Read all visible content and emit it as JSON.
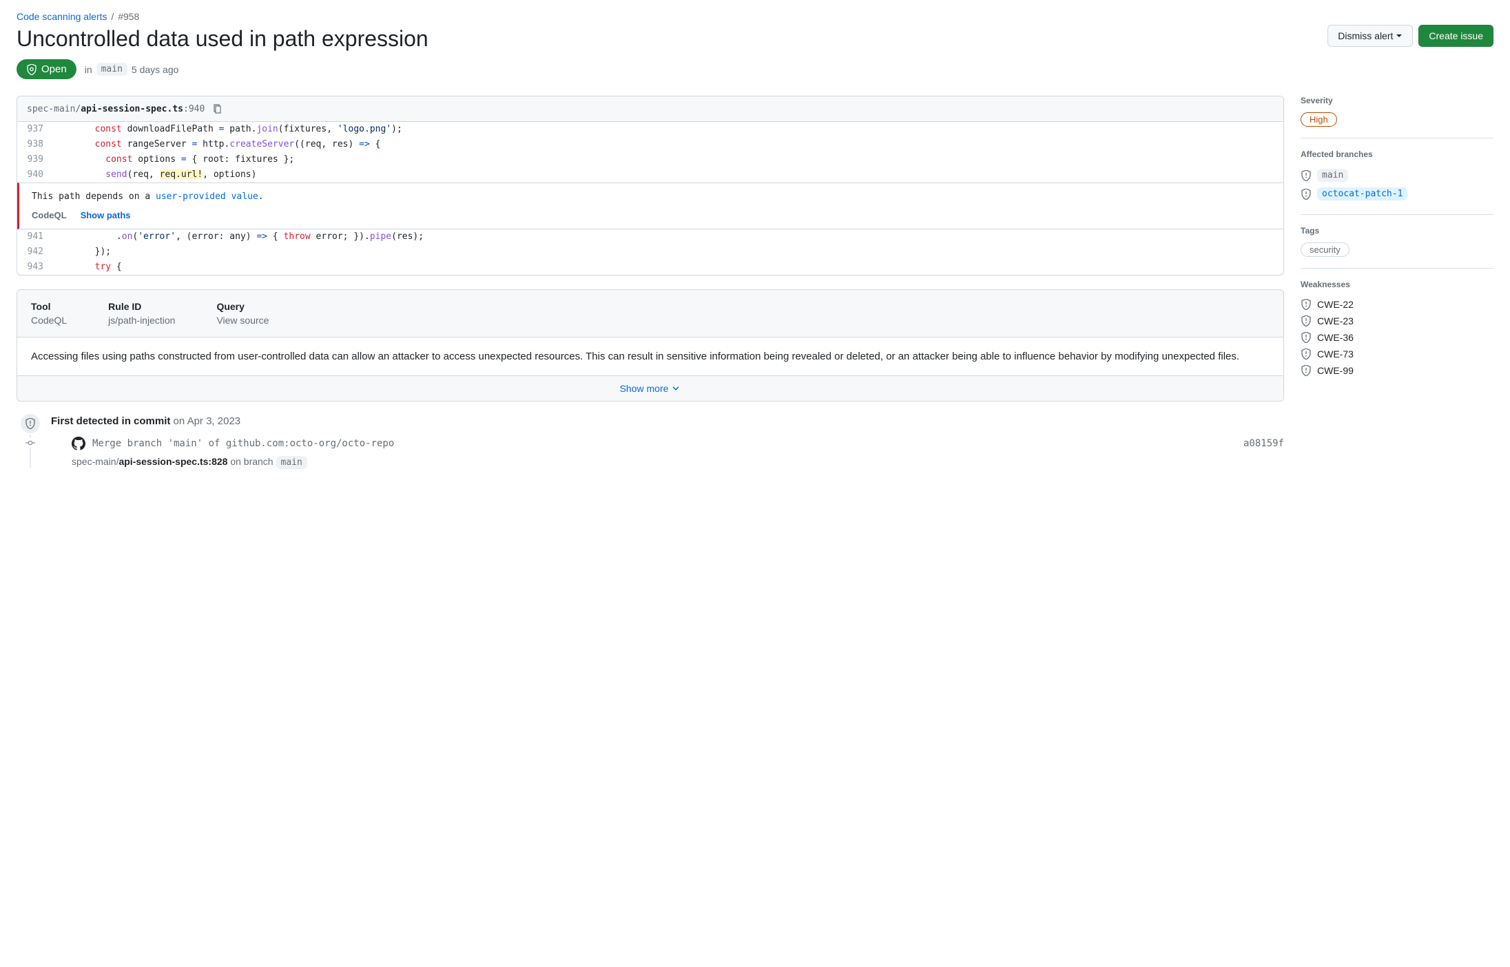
{
  "breadcrumb": {
    "parent": "Code scanning alerts",
    "id": "#958"
  },
  "title": "Uncontrolled data used in path expression",
  "actions": {
    "dismiss": "Dismiss alert",
    "create_issue": "Create issue"
  },
  "status": {
    "label": "Open",
    "in": "in",
    "branch": "main",
    "age": "5 days ago"
  },
  "code_header": {
    "path_prefix": "spec-main/",
    "path_bold": "api-session-spec.ts",
    "line": ":940"
  },
  "code_lines": {
    "937": {
      "ln": "937"
    },
    "938": {
      "ln": "938"
    },
    "939": {
      "ln": "939"
    },
    "940": {
      "ln": "940"
    },
    "941": {
      "ln": "941"
    },
    "942": {
      "ln": "942"
    },
    "943": {
      "ln": "943"
    }
  },
  "code_tokens": {
    "l937_const": "const",
    "l937_var": " downloadFilePath ",
    "l937_eq": "=",
    "l937_sp": " path.",
    "l937_join": "join",
    "l937_p1": "(fixtures, ",
    "l937_str": "'logo.png'",
    "l937_p2": ");",
    "l938_const": "const",
    "l938_var": " rangeServer ",
    "l938_eq": "=",
    "l938_sp": " http.",
    "l938_create": "createServer",
    "l938_p1": "((req, res) ",
    "l938_arrow": "=>",
    "l938_p2": " {",
    "l939_const": "const",
    "l939_var": " options ",
    "l939_eq": "=",
    "l939_rest": " { root: fixtures };",
    "l940_send": "send",
    "l940_p1": "(req, ",
    "l940_hl": "req.url!",
    "l940_p2": ", options)",
    "l941_on": "on",
    "l941_p0": ".",
    "l941_p1": "(",
    "l941_str": "'error'",
    "l941_p2": ", (error: any) ",
    "l941_arrow": "=>",
    "l941_p3": " { ",
    "l941_throw": "throw",
    "l941_p4": " error; }).",
    "l941_pipe": "pipe",
    "l941_p5": "(res);",
    "l942": "});",
    "l943_try": "try",
    "l943_rest": " {"
  },
  "inline_msg": {
    "prefix": "This path depends on a ",
    "link": "user-provided value",
    "suffix": ".",
    "tool": "CodeQL",
    "show_paths": "Show paths"
  },
  "details": {
    "tool_h": "Tool",
    "tool_v": "CodeQL",
    "rule_h": "Rule ID",
    "rule_v": "js/path-injection",
    "query_h": "Query",
    "query_v": "View source",
    "body": "Accessing files using paths constructed from user-controlled data can allow an attacker to access unexpected resources. This can result in sensitive information being revealed or deleted, or an attacker being able to influence behavior by modifying unexpected files.",
    "show_more": "Show more"
  },
  "timeline": {
    "first_detected_label": "First detected in commit",
    "first_detected_date": " on Apr 3, 2023",
    "commit_msg": "Merge branch 'main' of github.com:octo-org/octo-repo",
    "sha": "a08159f",
    "path_prefix": "spec-main/",
    "path_bold": "api-session-spec.ts:828",
    "on_branch": " on branch ",
    "branch": "main"
  },
  "sidebar": {
    "severity_h": "Severity",
    "severity_v": "High",
    "branches_h": "Affected branches",
    "branches": [
      {
        "name": "main",
        "hl": false
      },
      {
        "name": "octocat-patch-1",
        "hl": true
      }
    ],
    "tags_h": "Tags",
    "tags": [
      "security"
    ],
    "weak_h": "Weaknesses",
    "weak": [
      "CWE-22",
      "CWE-23",
      "CWE-36",
      "CWE-73",
      "CWE-99"
    ]
  }
}
